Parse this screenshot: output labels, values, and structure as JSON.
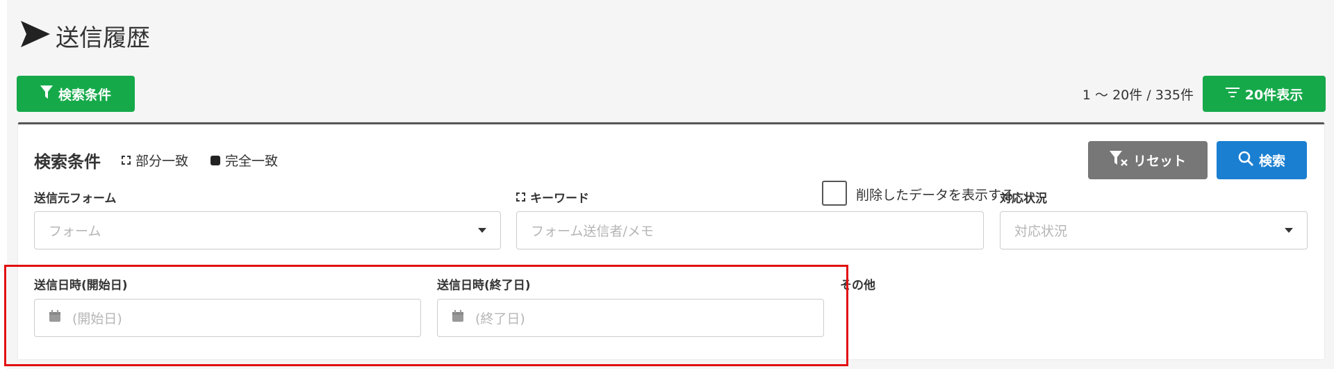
{
  "page": {
    "title": "送信履歴",
    "title_icon": "paper-plane-icon"
  },
  "toolbar": {
    "conditions_button": "検索条件",
    "result_count": "1 〜 20件 / 335件",
    "page_size_button": "20件表示"
  },
  "panel": {
    "title": "検索条件",
    "legend_partial": "部分一致",
    "legend_exact": "完全一致",
    "reset_button": "リセット",
    "search_button": "検索"
  },
  "fields": {
    "form_label": "送信元フォーム",
    "form_placeholder": "フォーム",
    "keyword_label": "キーワード",
    "keyword_placeholder": "フォーム送信者/メモ",
    "status_label": "対応状況",
    "status_placeholder": "対応状況",
    "date_start_label": "送信日時(開始日)",
    "date_start_placeholder": "(開始日)",
    "date_end_label": "送信日時(終了日)",
    "date_end_placeholder": "(終了日)",
    "other_label": "その他",
    "show_deleted_label": "削除したデータを表示する"
  },
  "colors": {
    "green": "#16a94a",
    "blue": "#1a7fd1",
    "gray": "#777777",
    "highlight": "#e20e0e"
  }
}
